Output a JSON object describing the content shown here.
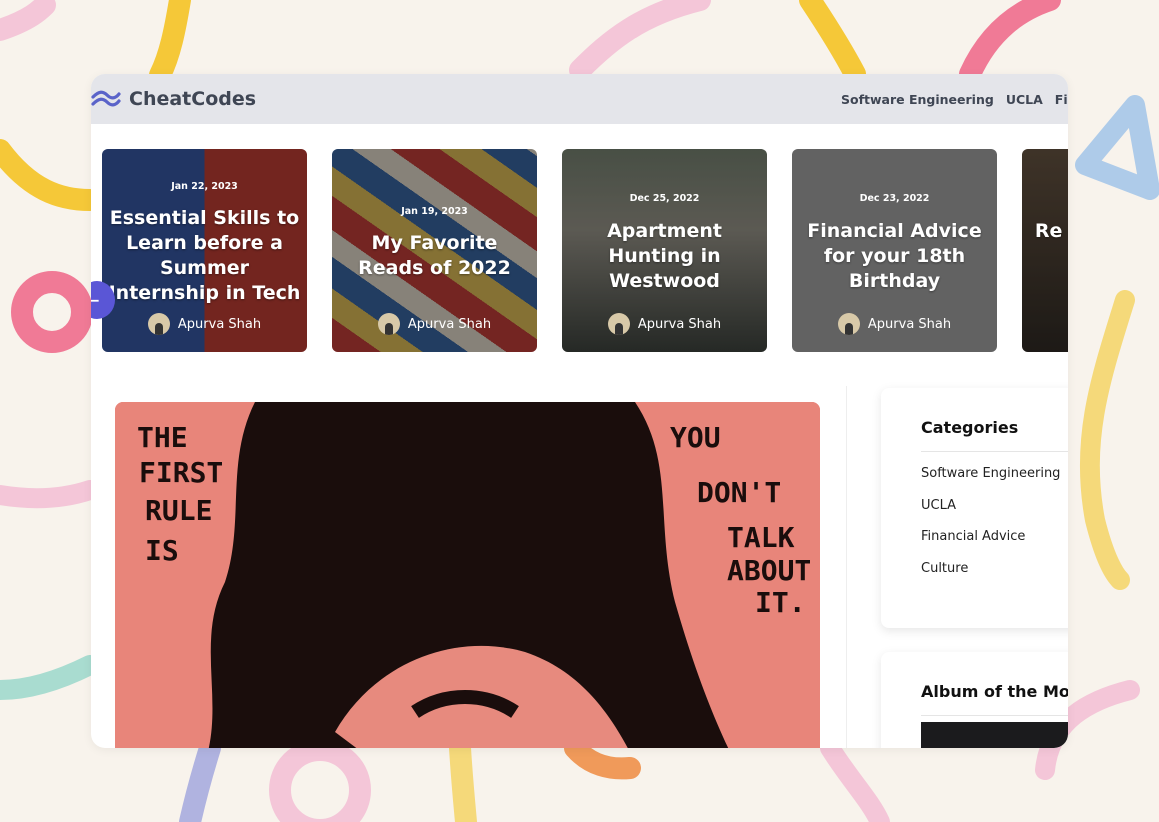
{
  "brand": {
    "name": "CheatCodes"
  },
  "nav": {
    "items": [
      "Software Engineering",
      "UCLA",
      "Finan"
    ]
  },
  "carousel": {
    "cards": [
      {
        "date": "Jan 22, 2023",
        "title": "Essential Skills to Learn before a Summer Internship in Tech",
        "author": "Apurva Shah"
      },
      {
        "date": "Jan 19, 2023",
        "title": "My Favorite Reads of 2022",
        "author": "Apurva Shah"
      },
      {
        "date": "Dec 25, 2022",
        "title": "Apartment Hunting in Westwood",
        "author": "Apurva Shah"
      },
      {
        "date": "Dec 23, 2022",
        "title": "Financial Advice for your 18th Birthday",
        "author": "Apurva Shah"
      },
      {
        "date": "",
        "title": "Re E",
        "author": ""
      }
    ]
  },
  "hero": {
    "text_left": [
      "THE",
      "FIRST",
      "RULE",
      "IS"
    ],
    "text_right": [
      "YOU",
      "DON'T",
      "TALK",
      "ABOUT",
      "IT."
    ]
  },
  "sidebar": {
    "categories_title": "Categories",
    "categories": [
      "Software Engineering",
      "UCLA",
      "Financial Advice",
      "Culture"
    ],
    "album_title": "Album of the Mont"
  },
  "colors": {
    "accent": "#5a56d6",
    "navbar": "#e4e5ea",
    "text": "#3f4654"
  }
}
